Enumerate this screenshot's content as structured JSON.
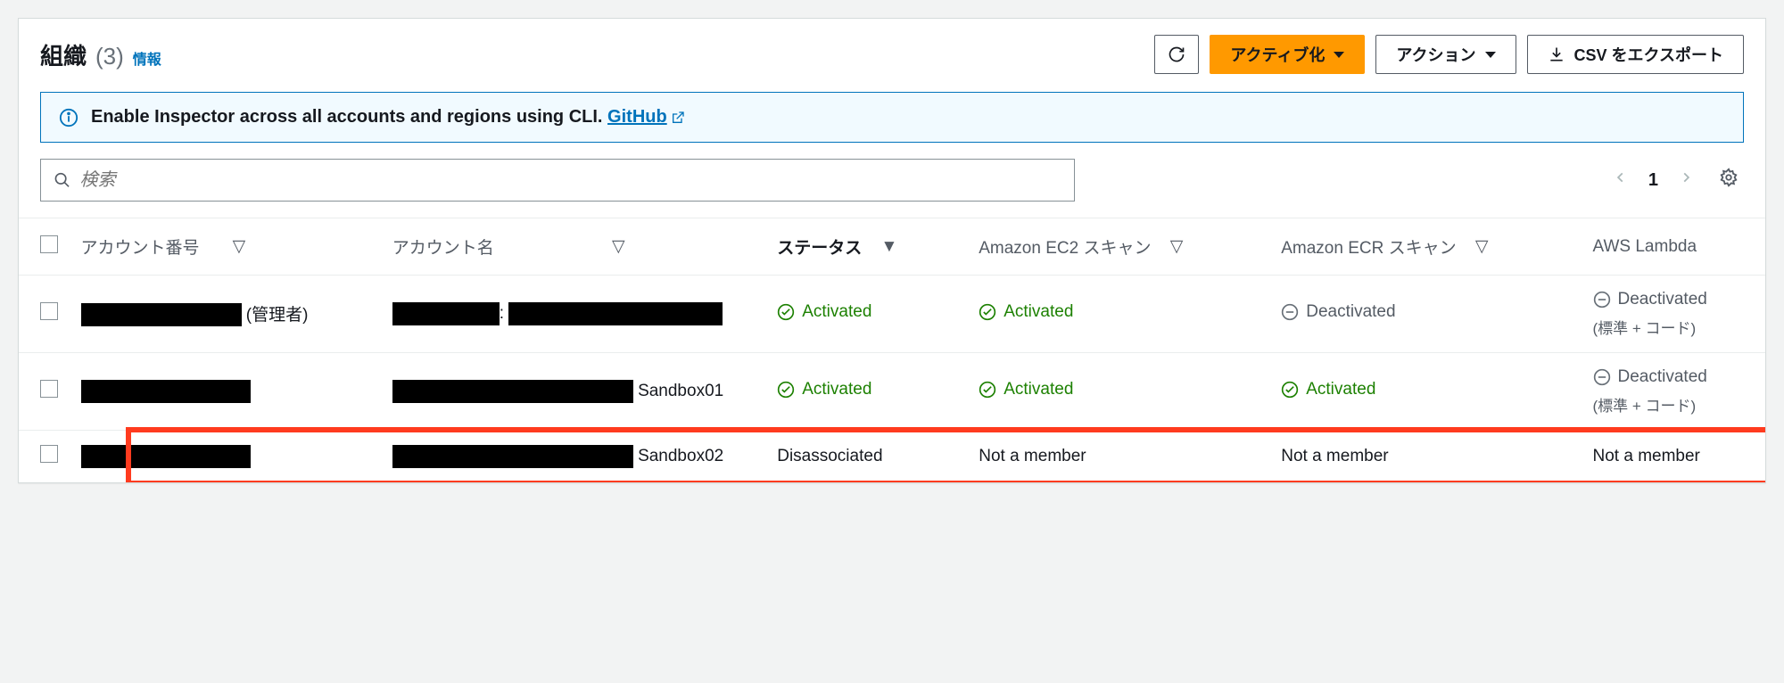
{
  "header": {
    "title": "組織",
    "count": "(3)",
    "info": "情報"
  },
  "buttons": {
    "activate": "アクティブ化",
    "actions": "アクション",
    "export": "CSV をエクスポート"
  },
  "alert": {
    "text": "Enable Inspector across all accounts and regions using CLI.",
    "link": "GitHub"
  },
  "search": {
    "placeholder": "検索"
  },
  "pager": {
    "page": "1"
  },
  "columns": {
    "acctnum": "アカウント番号",
    "acctname": "アカウント名",
    "status": "ステータス",
    "ec2": "Amazon EC2 スキャン",
    "ecr": "Amazon ECR スキャン",
    "lambda": "AWS Lambda"
  },
  "rows": [
    {
      "acctnum_suffix": "(管理者)",
      "acctname_suffix": "",
      "status": {
        "label": "Activated",
        "state": "ok"
      },
      "ec2": {
        "label": "Activated",
        "state": "ok"
      },
      "ecr": {
        "label": "Deactivated",
        "state": "off"
      },
      "lambda": {
        "label": "Deactivated",
        "state": "off",
        "sub": "(標準 + コード)"
      }
    },
    {
      "acctnum_suffix": "",
      "acctname_suffix": "Sandbox01",
      "status": {
        "label": "Activated",
        "state": "ok"
      },
      "ec2": {
        "label": "Activated",
        "state": "ok"
      },
      "ecr": {
        "label": "Activated",
        "state": "ok"
      },
      "lambda": {
        "label": "Deactivated",
        "state": "off",
        "sub": "(標準 + コード)"
      }
    },
    {
      "acctnum_suffix": "",
      "acctname_suffix": "Sandbox02",
      "status": {
        "label": "Disassociated",
        "state": "plain"
      },
      "ec2": {
        "label": "Not a member",
        "state": "plain"
      },
      "ecr": {
        "label": "Not a member",
        "state": "plain"
      },
      "lambda": {
        "label": "Not a member",
        "state": "plain",
        "sub": ""
      }
    }
  ]
}
